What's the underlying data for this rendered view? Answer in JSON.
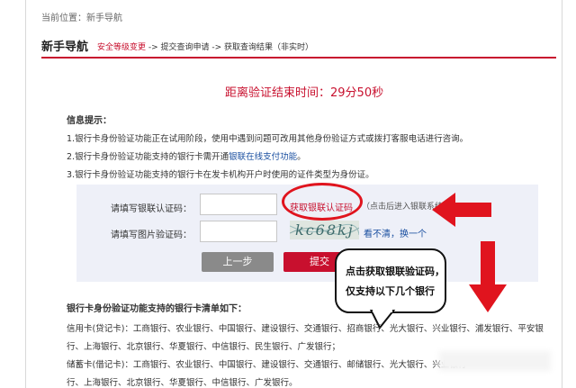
{
  "breadcrumb": "当前位置：新手导航",
  "header": {
    "title": "新手导航",
    "step_current": "安全等级变更",
    "step_rest": " -> 提交查询申请 -> 获取查询结果（非实时）"
  },
  "timer": {
    "label": "距离验证结束时间：",
    "value": "29分50秒"
  },
  "info": {
    "title": "信息提示：",
    "line1": "1.银行卡身份验证功能正在试用阶段，使用中遇到问题可改用其他身份验证方式或拨打客服电话进行咨询。",
    "line2_prefix": "2.银行卡身份验证功能支持的银行卡需开通",
    "line2_link": "银联在线支付功能",
    "line2_suffix": "。",
    "line3": "3.银行卡身份验证功能支持的银行卡在发卡机构开户时使用的证件类型为身份证。"
  },
  "form": {
    "unionpay_label": "请填写银联认证码：",
    "get_code": "获取银联认证码",
    "get_code_hint": "（点击后进入银联系统）",
    "captcha_label": "请填写图片验证码：",
    "captcha_text": "kc68kj",
    "refresh": "看不清，换一个",
    "prev_button": "上一步",
    "submit_button": "提交"
  },
  "callout": {
    "line1": "点击获取银联验证码，",
    "line2": "仅支持以下几个银行"
  },
  "banks": {
    "title": "银行卡身份验证功能支持的银行卡清单如下：",
    "credit_line1": "信用卡(贷记卡)：工商银行、农业银行、中国银行、建设银行、交通银行、招商银行、光大银行、兴业银行、浦发银行、平安银",
    "credit_line2": "行、上海银行、北京银行、华夏银行、中信银行、民生银行、广发银行；",
    "debit_line1": "储蓄卡(借记卡)：工商银行、农业银行、中国银行、建设银行、交通银行、邮储银行、光大银行、兴业银行",
    "debit_line2": "行、上海银行、北京银行、华夏银行、中信银行、广发银行。"
  },
  "colors": {
    "accent": "#c8102e",
    "link": "#1a4fa0",
    "annotation": "#e0141e"
  }
}
